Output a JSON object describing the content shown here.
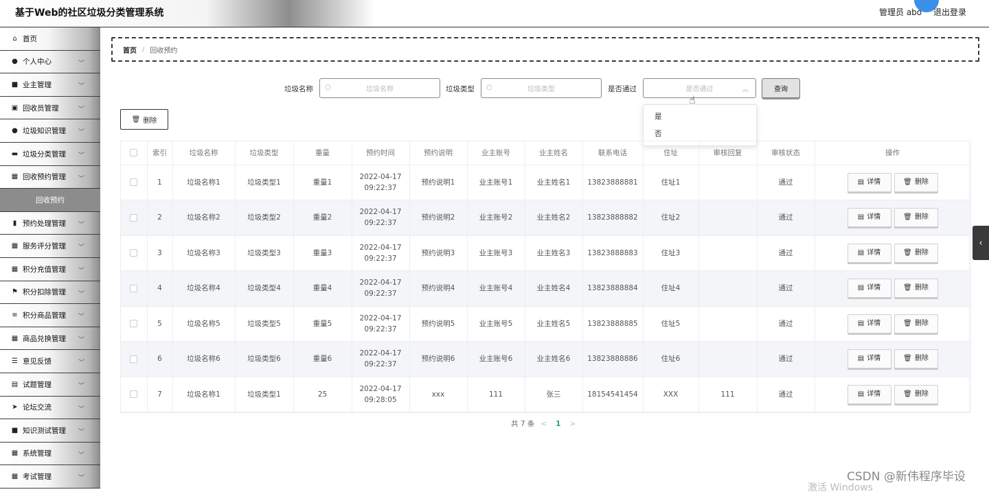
{
  "header": {
    "title": "基于Web的社区垃圾分类管理系统",
    "user": "管理员 abo",
    "logout": "退出登录"
  },
  "sidebar": {
    "items": [
      {
        "label": "首页",
        "icon": "home-icon",
        "glyph": "⌂",
        "chevron": false
      },
      {
        "label": "个人中心",
        "icon": "person-icon",
        "glyph": "●",
        "chevron": true
      },
      {
        "label": "业主管理",
        "icon": "briefcase-icon",
        "glyph": "■",
        "chevron": true
      },
      {
        "label": "回收员管理",
        "icon": "id-card-icon",
        "glyph": "▣",
        "chevron": true
      },
      {
        "label": "垃圾知识管理",
        "icon": "user-icon",
        "glyph": "●",
        "chevron": true
      },
      {
        "label": "垃圾分类管理",
        "icon": "truck-icon",
        "glyph": "▬",
        "chevron": true
      },
      {
        "label": "回收预约管理",
        "icon": "grid-icon",
        "glyph": "▦",
        "chevron": true
      }
    ],
    "active_sub": "回收预约",
    "items2": [
      {
        "label": "预约处理管理",
        "icon": "bar-chart-icon",
        "glyph": "▮",
        "chevron": true
      },
      {
        "label": "服务评分管理",
        "icon": "grid-icon",
        "glyph": "▦",
        "chevron": true
      },
      {
        "label": "积分充值管理",
        "icon": "grid-icon",
        "glyph": "▦",
        "chevron": true
      },
      {
        "label": "积分扣除管理",
        "icon": "flag-icon",
        "glyph": "⚑",
        "chevron": true
      },
      {
        "label": "积分商品管理",
        "icon": "list-icon",
        "glyph": "≡",
        "chevron": true
      },
      {
        "label": "商品兑换管理",
        "icon": "grid-icon",
        "glyph": "▦",
        "chevron": true
      },
      {
        "label": "意见反馈",
        "icon": "sliders-icon",
        "glyph": "☰",
        "chevron": true
      },
      {
        "label": "试题管理",
        "icon": "clipboard-icon",
        "glyph": "▤",
        "chevron": true
      },
      {
        "label": "论坛交流",
        "icon": "send-icon",
        "glyph": "➤",
        "chevron": true
      },
      {
        "label": "知识测试管理",
        "icon": "book-icon",
        "glyph": "■",
        "chevron": true
      },
      {
        "label": "系统管理",
        "icon": "grid-icon",
        "glyph": "▦",
        "chevron": true
      },
      {
        "label": "考试管理",
        "icon": "grid-icon",
        "glyph": "▦",
        "chevron": true
      }
    ]
  },
  "breadcrumb": {
    "home": "首页",
    "current": "回收预约"
  },
  "filters": {
    "name_label": "垃圾名称",
    "name_placeholder": "垃圾名称",
    "type_label": "垃圾类型",
    "type_placeholder": "垃圾类型",
    "pass_label": "是否通过",
    "pass_placeholder": "是否通过",
    "query": "查询",
    "pass_options": [
      "是",
      "否"
    ]
  },
  "toolbar": {
    "delete": "删除"
  },
  "table": {
    "headers": [
      "索引",
      "垃圾名称",
      "垃圾类型",
      "重量",
      "预约时间",
      "预约说明",
      "业主账号",
      "业主姓名",
      "联系电话",
      "住址",
      "审核回复",
      "审核状态",
      "操作"
    ],
    "rows": [
      [
        "1",
        "垃圾名称1",
        "垃圾类型1",
        "重量1",
        "2022-04-17 09:22:37",
        "预约说明1",
        "业主账号1",
        "业主姓名1",
        "13823888881",
        "住址1",
        "",
        "通过"
      ],
      [
        "2",
        "垃圾名称2",
        "垃圾类型2",
        "重量2",
        "2022-04-17 09:22:37",
        "预约说明2",
        "业主账号2",
        "业主姓名2",
        "13823888882",
        "住址2",
        "",
        "通过"
      ],
      [
        "3",
        "垃圾名称3",
        "垃圾类型3",
        "重量3",
        "2022-04-17 09:22:37",
        "预约说明3",
        "业主账号3",
        "业主姓名3",
        "13823888883",
        "住址3",
        "",
        "通过"
      ],
      [
        "4",
        "垃圾名称4",
        "垃圾类型4",
        "重量4",
        "2022-04-17 09:22:37",
        "预约说明4",
        "业主账号4",
        "业主姓名4",
        "13823888884",
        "住址4",
        "",
        "通过"
      ],
      [
        "5",
        "垃圾名称5",
        "垃圾类型5",
        "重量5",
        "2022-04-17 09:22:37",
        "预约说明5",
        "业主账号5",
        "业主姓名5",
        "13823888885",
        "住址5",
        "",
        "通过"
      ],
      [
        "6",
        "垃圾名称6",
        "垃圾类型6",
        "重量6",
        "2022-04-17 09:22:37",
        "预约说明6",
        "业主账号6",
        "业主姓名6",
        "13823888886",
        "住址6",
        "",
        "通过"
      ],
      [
        "7",
        "垃圾名称1",
        "垃圾类型1",
        "25",
        "2022-04-17 09:28:05",
        "xxx",
        "111",
        "张三",
        "18154541454",
        "XXX",
        "111",
        "通过"
      ]
    ],
    "detail": "详情",
    "delete": "删除"
  },
  "pagination": {
    "total": "共 7 条",
    "page": "1"
  },
  "watermark": "CSDN @新伟程序毕设",
  "watermark2": "激活 Windows"
}
